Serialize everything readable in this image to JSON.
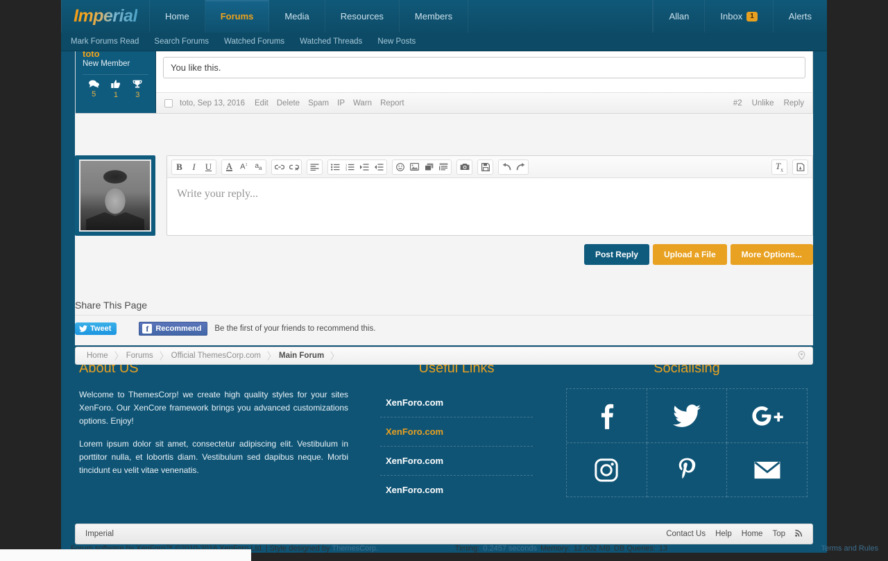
{
  "header": {
    "logo": "Imperial",
    "nav": [
      {
        "label": "Home",
        "active": false
      },
      {
        "label": "Forums",
        "active": true
      },
      {
        "label": "Media",
        "active": false
      },
      {
        "label": "Resources",
        "active": false
      },
      {
        "label": "Members",
        "active": false
      }
    ],
    "user": "Allan",
    "inbox": "Inbox",
    "inbox_count": "1",
    "alerts": "Alerts"
  },
  "subnav": [
    "Mark Forums Read",
    "Search Forums",
    "Watched Forums",
    "Watched Threads",
    "New Posts"
  ],
  "post": {
    "author": "toto",
    "user_title": "New Member",
    "stats": [
      {
        "icon": "messages-icon",
        "value": "5"
      },
      {
        "icon": "likes-icon",
        "value": "1"
      },
      {
        "icon": "trophies-icon",
        "value": "3"
      }
    ],
    "message": "You like this.",
    "meta": "toto, Sep 13, 2016",
    "actions": [
      "Edit",
      "Delete",
      "Spam",
      "IP",
      "Warn",
      "Report"
    ],
    "number": "#2",
    "like_label": "Unlike",
    "reply_label": "Reply"
  },
  "editor": {
    "placeholder": "Write your reply...",
    "toolbar": [
      {
        "group": 1,
        "icons": [
          "bold-icon",
          "italic-icon",
          "underline-icon"
        ]
      },
      {
        "group": 2,
        "icons": [
          "text-color-icon",
          "font-size-icon",
          "font-family-icon"
        ]
      },
      {
        "group": 3,
        "icons": [
          "link-icon",
          "unlink-icon"
        ]
      },
      {
        "group": 4,
        "icons": [
          "align-left-icon"
        ]
      },
      {
        "group": 5,
        "icons": [
          "bullet-list-icon",
          "numbered-list-icon",
          "indent-icon",
          "outdent-icon"
        ]
      },
      {
        "group": 6,
        "icons": [
          "smilie-icon",
          "image-icon",
          "media-icon",
          "quote-icon"
        ]
      },
      {
        "group": 7,
        "icons": [
          "camera-icon"
        ]
      },
      {
        "group": 8,
        "icons": [
          "draft-save-icon"
        ]
      },
      {
        "group": 9,
        "icons": [
          "undo-icon",
          "redo-icon"
        ]
      },
      {
        "group": 10,
        "icons": [
          "remove-formatting-icon"
        ]
      },
      {
        "group": 11,
        "icons": [
          "toggle-bbcode-icon"
        ]
      }
    ],
    "buttons": {
      "post_reply": "Post Reply",
      "upload_file": "Upload a File",
      "more_options": "More Options..."
    }
  },
  "share": {
    "title": "Share This Page",
    "tweet": "Tweet",
    "recommend": "Recommend",
    "note": "Be the first of your friends to recommend this."
  },
  "breadcrumb": [
    "Home",
    "Forums",
    "Official ThemesCorp.com",
    "Main Forum"
  ],
  "footer": {
    "about": {
      "title": "About US",
      "p1": "Welcome to ThemesCorp! we create high quality styles for your sites XenForo. Our XenCore framework brings you advanced customizations options. Enjoy!",
      "p2": "Lorem ipsum dolor sit amet, consectetur adipiscing elit. Vestibulum in porttitor nulla, et lobortis diam. Vestibulum sed dapibus neque. Morbi tincidunt eu velit vitae venenatis."
    },
    "links": {
      "title": "Useful Links",
      "items": [
        {
          "label": "XenForo.com",
          "highlight": false
        },
        {
          "label": "XenForo.com",
          "highlight": true
        },
        {
          "label": "XenForo.com",
          "highlight": false
        },
        {
          "label": "XenForo.com",
          "highlight": false
        }
      ]
    },
    "social": {
      "title": "Socialising",
      "items": [
        "facebook-icon",
        "twitter-icon",
        "google-plus-icon",
        "instagram-icon",
        "pinterest-icon",
        "email-icon"
      ]
    }
  },
  "bottombar": {
    "style_name": "Imperial",
    "links": [
      "Contact Us",
      "Help",
      "Home",
      "Top"
    ],
    "rss_icon": "rss-icon"
  },
  "copyright": {
    "text_before": "Forum software by XenForo™ ©2010-2016 XenForo Ltd. | Style designed by ",
    "designer": "ThemesCorp.",
    "timing_label": "Timing:",
    "timing_value": "0.2457 seconds",
    "memory_label": "Memory:",
    "memory_value": "12.002 MB",
    "queries_label": "DB Queries:",
    "queries_value": "13",
    "terms": "Terms and Rules"
  },
  "colors": {
    "brand_blue": "#0f5475",
    "accent_orange": "#e8a121",
    "nav_active_text": "#f0a31a"
  }
}
